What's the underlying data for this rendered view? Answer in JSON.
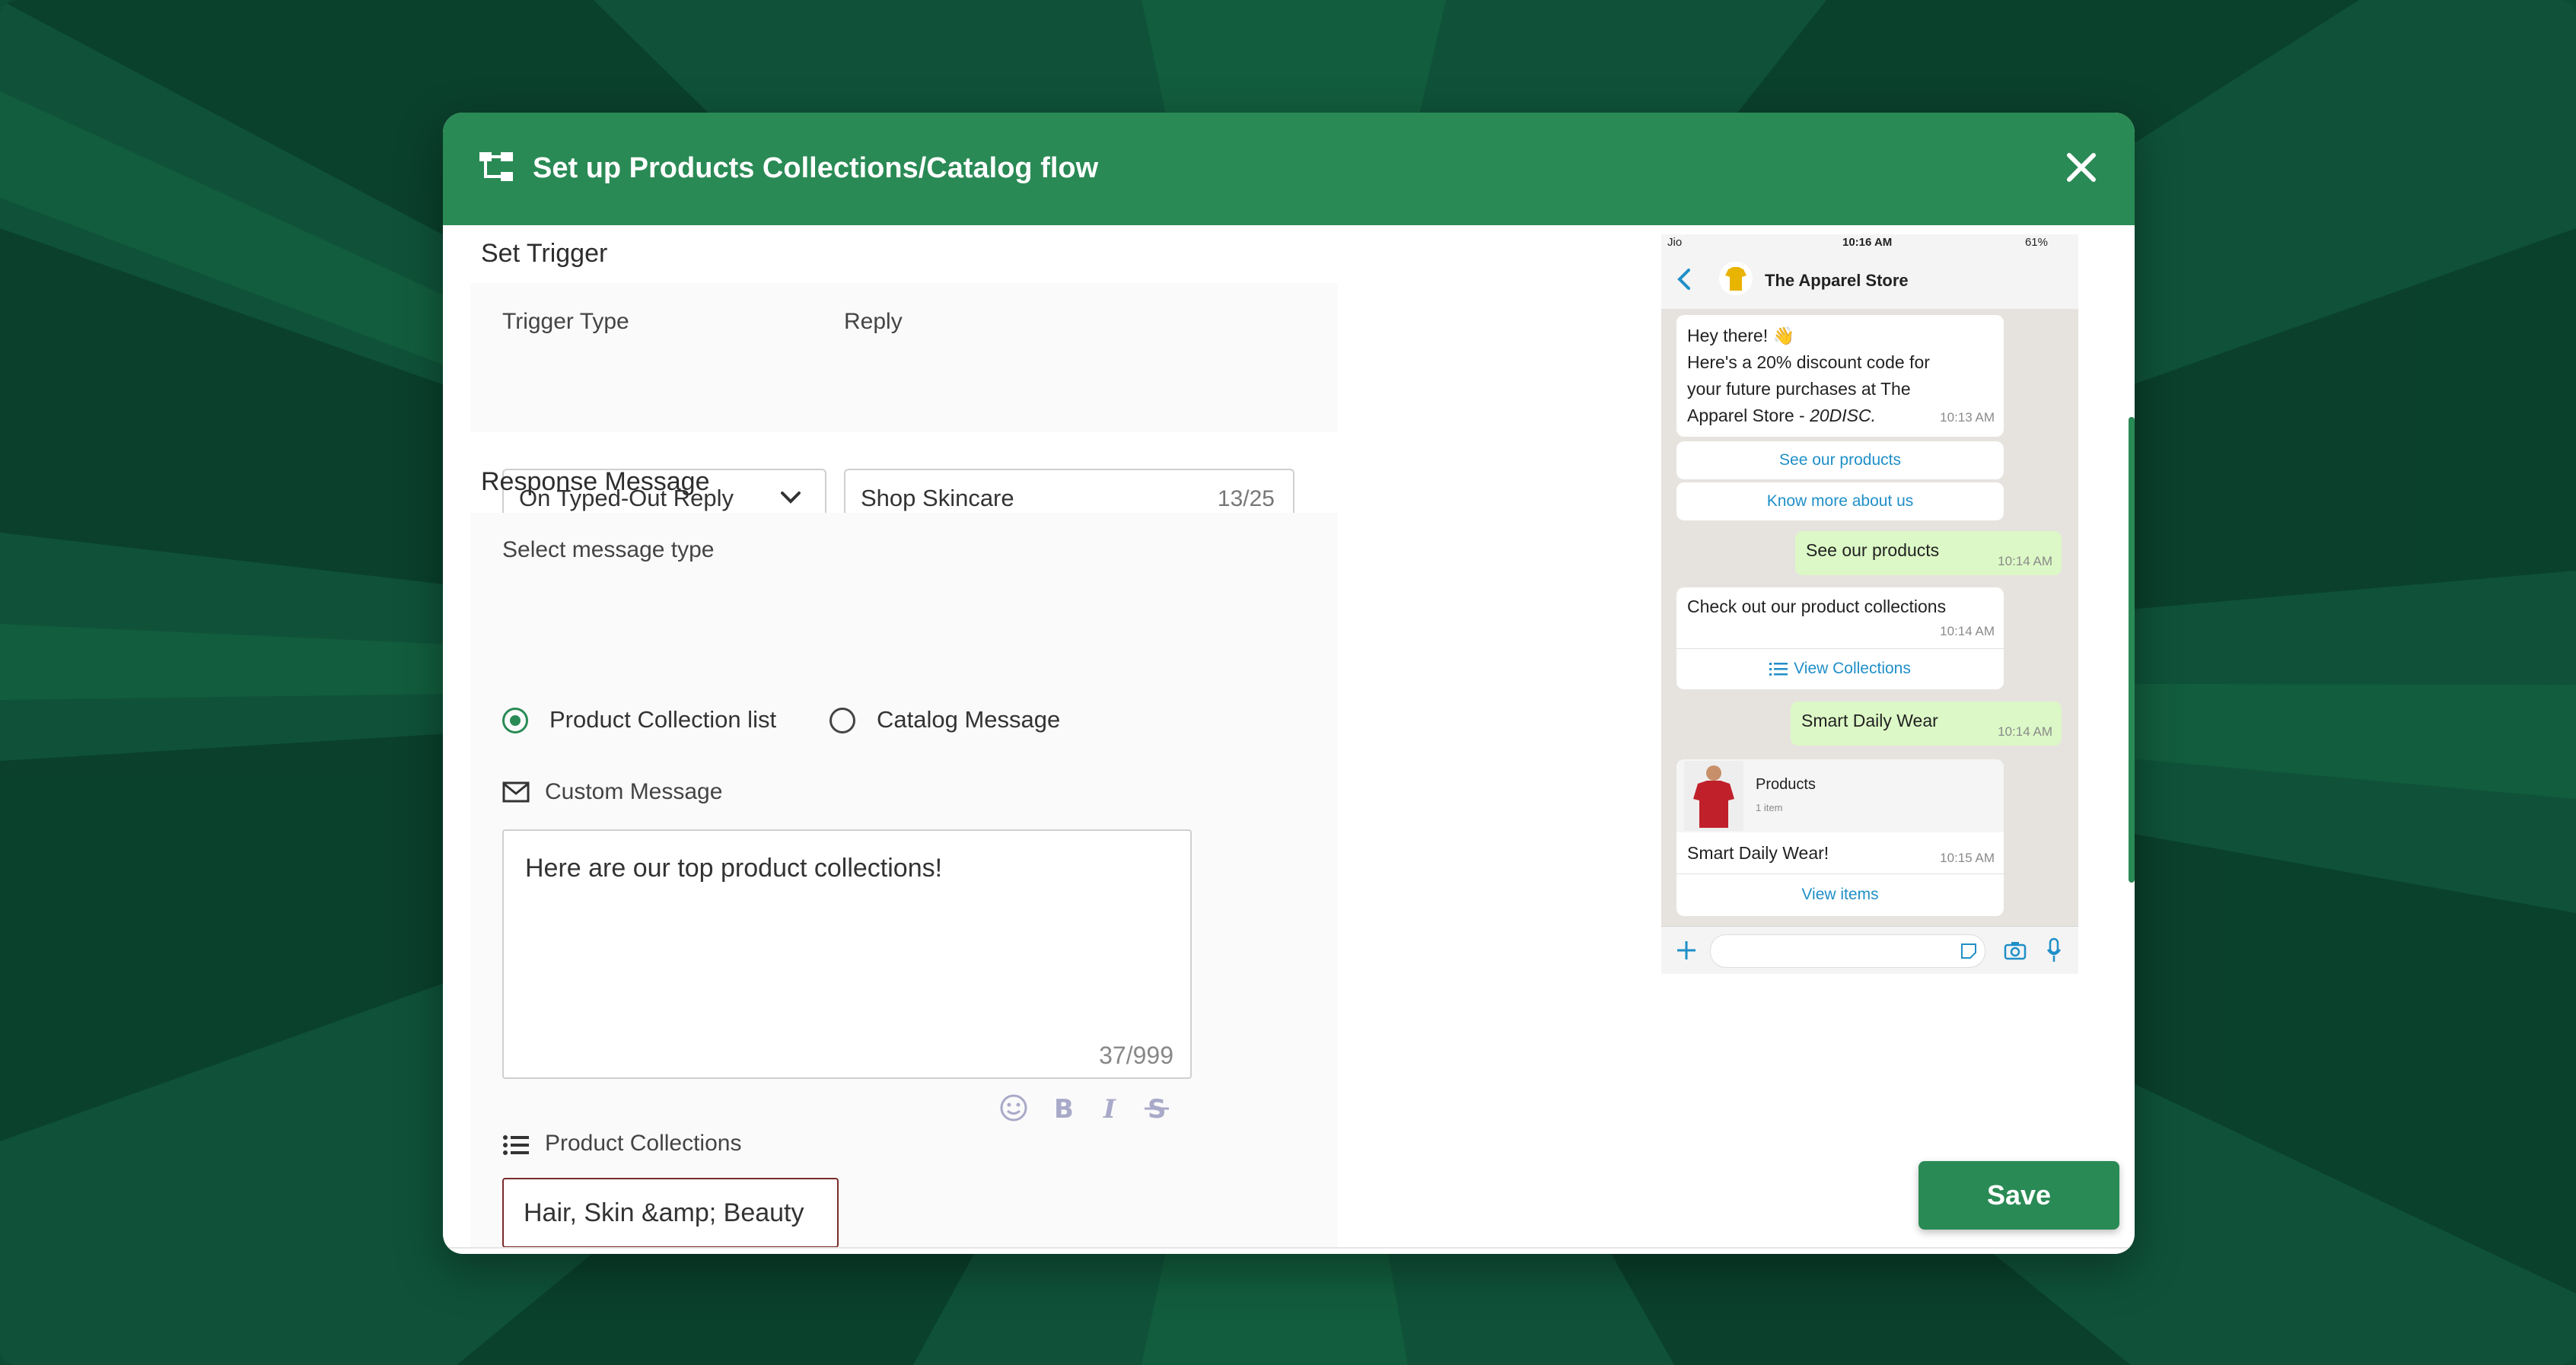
{
  "colors": {
    "brand_green": "#2a8a55",
    "background": "#0d4d36",
    "link_blue": "#1f8fc8",
    "outgoing_bubble": "#dcf8c6"
  },
  "modal": {
    "title": "Set up Products Collections/Catalog flow",
    "title_icon": "flow-icon",
    "close_icon": "close-icon"
  },
  "trigger": {
    "section_title": "Set Trigger",
    "type_label": "Trigger Type",
    "type_value": "On Typed-Out Reply",
    "reply_label": "Reply",
    "reply_value": "Shop Skincare",
    "reply_counter": "13/25"
  },
  "response": {
    "section_title": "Response Message",
    "message_type_label": "Select message type",
    "options": [
      {
        "label": "Product Collection list",
        "selected": true
      },
      {
        "label": "Catalog Message",
        "selected": false
      }
    ],
    "custom_message_label": "Custom Message",
    "custom_message_value": "Here are our top product collections!",
    "custom_message_counter": "37/999",
    "format_icons": [
      "emoji-icon",
      "bold-icon",
      "italic-icon",
      "strikethrough-icon"
    ],
    "collections_label": "Product Collections",
    "collections_value": "Hair, Skin &amp; Beauty"
  },
  "footer": {
    "save_label": "Save"
  },
  "phone": {
    "status": {
      "carrier": "Jio",
      "time": "10:16 AM",
      "battery": "61%"
    },
    "store_name": "The Apparel Store",
    "messages": {
      "greeting_line1": "Hey there! 👋",
      "greeting_line2": "Here's a 20% discount code for",
      "greeting_line3": "your future purchases at The",
      "greeting_line4": "Apparel Store - ",
      "greeting_code": "20DISC.",
      "greeting_time": "10:13 AM",
      "btn_see_products": "See our products",
      "btn_know_more": "Know more about us",
      "out1_text": "See our products",
      "out1_time": "10:14 AM",
      "collections_text": "Check out our product collections",
      "collections_time": "10:14 AM",
      "view_collections": "View Collections",
      "out2_text": "Smart Daily Wear",
      "out2_time": "10:14 AM",
      "product_title": "Products",
      "product_count": "1 item",
      "product_caption": "Smart Daily Wear!",
      "product_time": "10:15 AM",
      "view_items": "View items"
    }
  }
}
